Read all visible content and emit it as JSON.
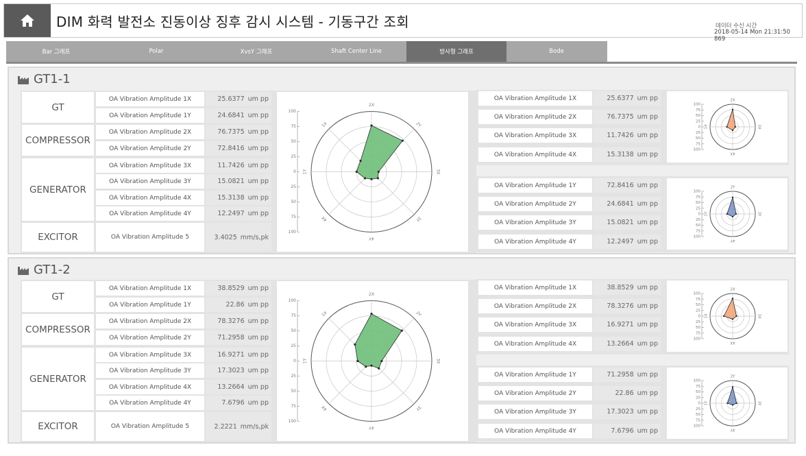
{
  "header": {
    "home_icon": "home-icon",
    "title": "DIM  화력 발전소 진동이상 징후 감시 시스템 - 기동구간 조회",
    "recv_label": "데이터 수신 시간",
    "recv_time": "2018-05-14 Mon 21:31:50 869"
  },
  "tabs": [
    {
      "label": "Bar 그래프",
      "active": false
    },
    {
      "label": "Polar",
      "active": false
    },
    {
      "label": "XvsY 그래프",
      "active": false
    },
    {
      "label": "Shaft Center Line",
      "active": false
    },
    {
      "label": "방사형 그래프",
      "active": true
    },
    {
      "label": "Bode",
      "active": false
    }
  ],
  "colors": {
    "green": "#6fbe7a",
    "orange": "#f2a77c",
    "blue": "#7d97c7"
  },
  "sections": [
    {
      "title": "GT1-1",
      "groups": [
        "GT",
        "COMPRESSOR",
        "GENERATOR",
        "EXCITOR"
      ],
      "rows": [
        {
          "label": "OA Vibration Amplitude 1X",
          "value": "25.6377",
          "unit": "um pp"
        },
        {
          "label": "OA Vibration Amplitude 1Y",
          "value": "24.6841",
          "unit": "um pp"
        },
        {
          "label": "OA Vibration Amplitude 2X",
          "value": "76.7375",
          "unit": "um pp"
        },
        {
          "label": "OA Vibration Amplitude 2Y",
          "value": "72.8416",
          "unit": "um pp"
        },
        {
          "label": "OA Vibration Amplitude 3X",
          "value": "11.7426",
          "unit": "um pp"
        },
        {
          "label": "OA Vibration Amplitude 3Y",
          "value": "15.0821",
          "unit": "um pp"
        },
        {
          "label": "OA Vibration Amplitude 4X",
          "value": "15.3138",
          "unit": "um pp"
        },
        {
          "label": "OA Vibration Amplitude 4Y",
          "value": "12.2497",
          "unit": "um pp"
        },
        {
          "label": "OA Vibration Amplitude 5",
          "value": "3.4025",
          "unit": "mm/s,pk"
        }
      ],
      "xbox": [
        {
          "label": "OA Vibration Amplitude 1X",
          "value": "25.6377",
          "unit": "um pp"
        },
        {
          "label": "OA Vibration Amplitude 2X",
          "value": "76.7375",
          "unit": "um pp"
        },
        {
          "label": "OA Vibration Amplitude 3X",
          "value": "11.7426",
          "unit": "um pp"
        },
        {
          "label": "OA Vibration Amplitude 4X",
          "value": "15.3138",
          "unit": "um pp"
        }
      ],
      "ybox": [
        {
          "label": "OA Vibration Amplitude 1Y",
          "value": "72.8416",
          "unit": "um pp"
        },
        {
          "label": "OA Vibration Amplitude 2Y",
          "value": "24.6841",
          "unit": "um pp"
        },
        {
          "label": "OA Vibration Amplitude 3Y",
          "value": "15.0821",
          "unit": "um pp"
        },
        {
          "label": "OA Vibration Amplitude 4Y",
          "value": "12.2497",
          "unit": "um pp"
        }
      ]
    },
    {
      "title": "GT1-2",
      "groups": [
        "GT",
        "COMPRESSOR",
        "GENERATOR",
        "EXCITOR"
      ],
      "rows": [
        {
          "label": "OA Vibration Amplitude 1X",
          "value": "38.8529",
          "unit": "um pp"
        },
        {
          "label": "OA Vibration Amplitude 1Y",
          "value": "22.86",
          "unit": "um pp"
        },
        {
          "label": "OA Vibration Amplitude 2X",
          "value": "78.3276",
          "unit": "um pp"
        },
        {
          "label": "OA Vibration Amplitude 2Y",
          "value": "71.2958",
          "unit": "um pp"
        },
        {
          "label": "OA Vibration Amplitude 3X",
          "value": "16.9271",
          "unit": "um pp"
        },
        {
          "label": "OA Vibration Amplitude 3Y",
          "value": "17.3023",
          "unit": "um pp"
        },
        {
          "label": "OA Vibration Amplitude 4X",
          "value": "13.2664",
          "unit": "um pp"
        },
        {
          "label": "OA Vibration Amplitude 4Y",
          "value": "7.6796",
          "unit": "um pp"
        },
        {
          "label": "OA Vibration Amplitude 5",
          "value": "2.2221",
          "unit": "mm/s,pk"
        }
      ],
      "xbox": [
        {
          "label": "OA Vibration Amplitude 1X",
          "value": "38.8529",
          "unit": "um pp"
        },
        {
          "label": "OA Vibration Amplitude 2X",
          "value": "78.3276",
          "unit": "um pp"
        },
        {
          "label": "OA Vibration Amplitude 3X",
          "value": "16.9271",
          "unit": "um pp"
        },
        {
          "label": "OA Vibration Amplitude 4X",
          "value": "13.2664",
          "unit": "um pp"
        }
      ],
      "ybox": [
        {
          "label": "OA Vibration Amplitude 1Y",
          "value": "71.2958",
          "unit": "um pp"
        },
        {
          "label": "OA Vibration Amplitude 2Y",
          "value": "22.86",
          "unit": "um pp"
        },
        {
          "label": "OA Vibration Amplitude 3Y",
          "value": "17.3023",
          "unit": "um pp"
        },
        {
          "label": "OA Vibration Amplitude 4Y",
          "value": "7.6796",
          "unit": "um pp"
        }
      ]
    }
  ],
  "chart_data": [
    {
      "type": "radar",
      "section": "GT1-1",
      "color": "green",
      "axes": [
        "2X",
        "2Y",
        "3X",
        "3Y",
        "4Y",
        "4X",
        "1Y",
        "1X"
      ],
      "values": [
        76.7375,
        72.8416,
        11.7426,
        15.0821,
        12.2497,
        15.3138,
        24.6841,
        25.6377
      ],
      "rlim": [
        0,
        100
      ],
      "ticks": [
        100,
        75,
        50,
        25,
        0,
        25,
        50,
        75,
        100
      ]
    },
    {
      "type": "radar",
      "section": "GT1-1",
      "color": "orange",
      "axes": [
        "2X",
        "3X",
        "4X",
        "1X"
      ],
      "values": [
        76.7375,
        11.7426,
        15.3138,
        25.6377
      ],
      "rlim": [
        0,
        100
      ],
      "ticks": [
        100,
        75,
        50,
        25,
        0,
        25,
        50,
        75,
        100
      ]
    },
    {
      "type": "radar",
      "section": "GT1-1",
      "color": "blue",
      "axes": [
        "2Y",
        "3Y",
        "4Y",
        "1Y"
      ],
      "values": [
        72.8416,
        15.0821,
        12.2497,
        24.6841
      ],
      "rlim": [
        0,
        100
      ],
      "ticks": [
        100,
        75,
        50,
        25,
        0,
        25,
        50,
        75,
        100
      ]
    },
    {
      "type": "radar",
      "section": "GT1-2",
      "color": "green",
      "axes": [
        "2X",
        "2Y",
        "3X",
        "3Y",
        "4Y",
        "4X",
        "1Y",
        "1X"
      ],
      "values": [
        78.3276,
        71.2958,
        16.9271,
        17.3023,
        7.6796,
        13.2664,
        22.86,
        38.8529
      ],
      "rlim": [
        0,
        100
      ],
      "ticks": [
        100,
        75,
        50,
        25,
        0,
        25,
        50,
        75,
        100
      ]
    },
    {
      "type": "radar",
      "section": "GT1-2",
      "color": "orange",
      "axes": [
        "2X",
        "3X",
        "4X",
        "1X"
      ],
      "values": [
        78.3276,
        16.9271,
        13.2664,
        38.8529
      ],
      "rlim": [
        0,
        100
      ],
      "ticks": [
        100,
        75,
        50,
        25,
        0,
        25,
        50,
        75,
        100
      ]
    },
    {
      "type": "radar",
      "section": "GT1-2",
      "color": "blue",
      "axes": [
        "2Y",
        "3Y",
        "4Y",
        "1Y"
      ],
      "values": [
        71.2958,
        17.3023,
        7.6796,
        22.86
      ],
      "rlim": [
        0,
        100
      ],
      "ticks": [
        100,
        75,
        50,
        25,
        0,
        25,
        50,
        75,
        100
      ]
    }
  ]
}
